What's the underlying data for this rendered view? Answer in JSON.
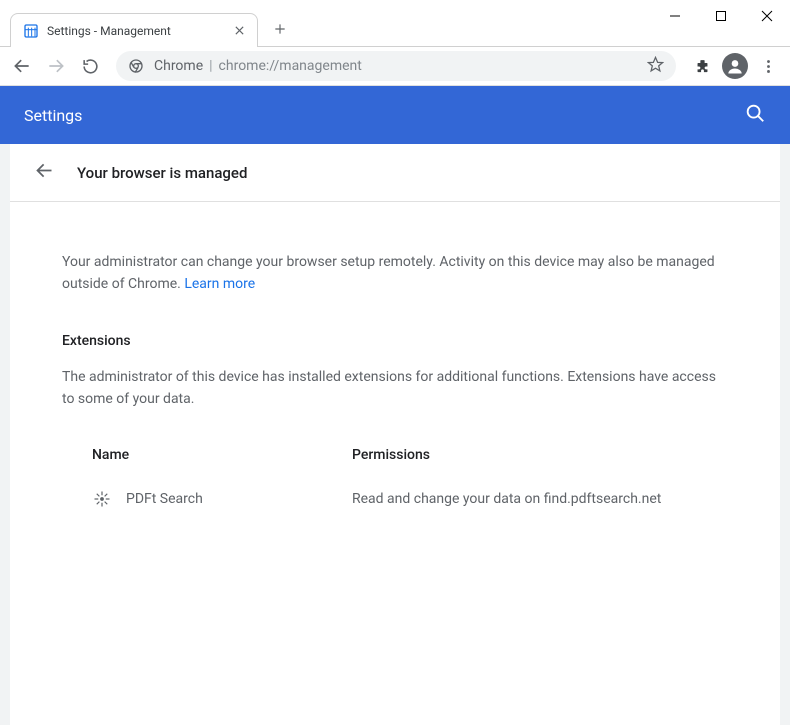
{
  "window": {
    "tab_title": "Settings - Management"
  },
  "omnibox": {
    "prefix": "Chrome",
    "url": "chrome://management"
  },
  "header": {
    "title": "Settings"
  },
  "subheader": {
    "title": "Your browser is managed"
  },
  "content": {
    "description": "Your administrator can change your browser setup remotely. Activity on this device may also be managed outside of Chrome. ",
    "learn_more": "Learn more",
    "extensions_heading": "Extensions",
    "extensions_desc": "The administrator of this device has installed extensions for additional functions. Extensions have access to some of your data.",
    "col_name": "Name",
    "col_perm": "Permissions",
    "extensions": [
      {
        "name": "PDFt Search",
        "permission": "Read and change your data on find.pdftsearch.net"
      }
    ]
  }
}
